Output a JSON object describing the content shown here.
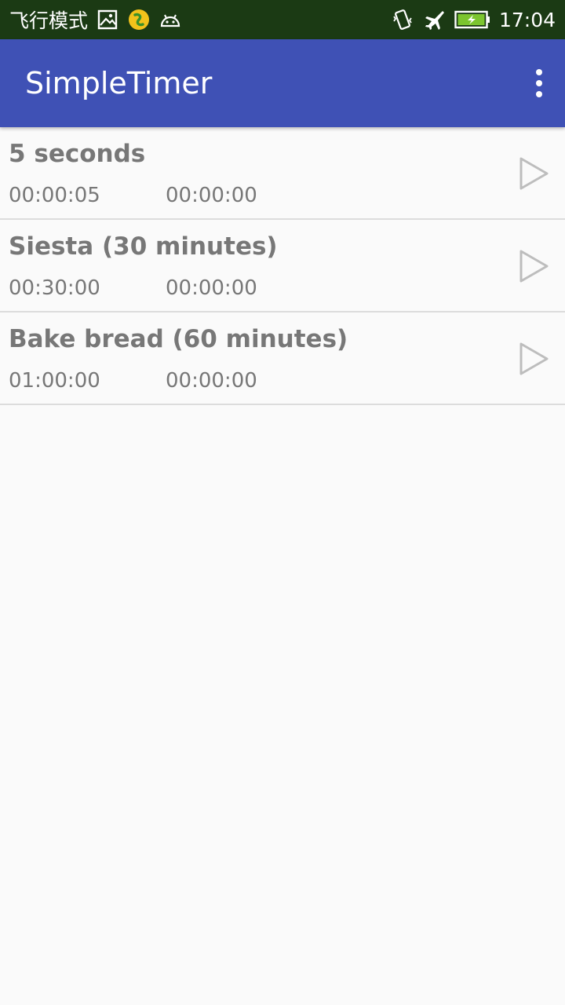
{
  "status_bar": {
    "mode_label": "飞行模式",
    "time": "17:04",
    "icons": [
      "image-icon",
      "music-icon",
      "android-icon",
      "vibrate-icon",
      "airplane-icon",
      "battery-charging-icon"
    ],
    "background": "#1b3a14"
  },
  "app_bar": {
    "title": "SimpleTimer",
    "menu_icon": "overflow-menu-icon",
    "color": "#3f51b5"
  },
  "timers": [
    {
      "name": "5 seconds",
      "duration": "00:00:05",
      "remaining": "00:00:00"
    },
    {
      "name": "Siesta (30 minutes)",
      "duration": "00:30:00",
      "remaining": "00:00:00"
    },
    {
      "name": "Bake bread (60 minutes)",
      "duration": "01:00:00",
      "remaining": "00:00:00"
    }
  ],
  "colors": {
    "text": "#777777",
    "play_icon": "#bdbdbd",
    "divider": "#dcdcdc",
    "background": "#fafafa"
  }
}
